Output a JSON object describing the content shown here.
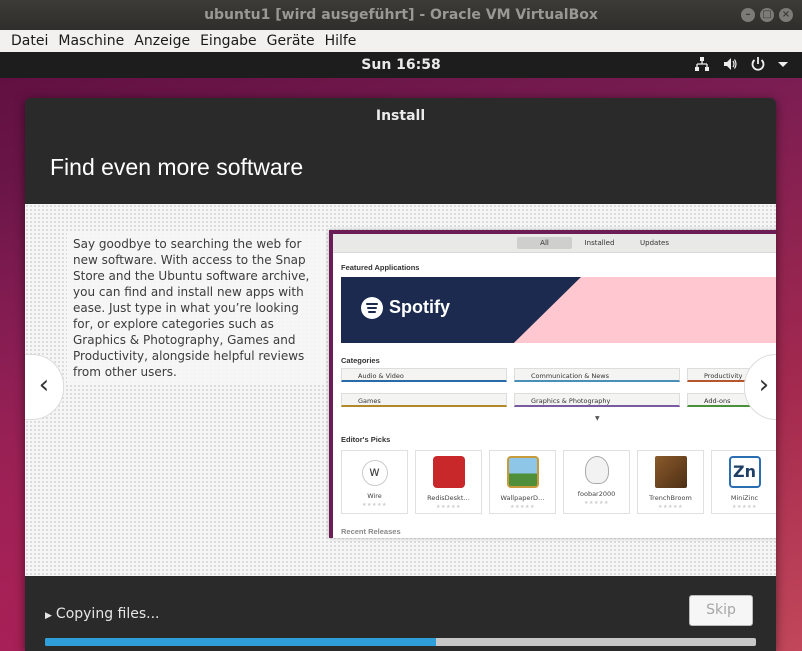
{
  "window": {
    "title": "ubuntu1 [wird ausgeführt] - Oracle VM VirtualBox",
    "controls": [
      "minimize-icon",
      "maximize-icon",
      "close-icon"
    ]
  },
  "menu": [
    "Datei",
    "Maschine",
    "Anzeige",
    "Eingabe",
    "Geräte",
    "Hilfe"
  ],
  "topbar": {
    "clock": "Sun 16:58",
    "icons": [
      "network-icon",
      "volume-icon",
      "power-icon",
      "chevron-down-icon"
    ]
  },
  "dialog": {
    "title": "Install",
    "heading": "Find even more software",
    "slide_text": "Say goodbye to searching the web for new software. With access to the Snap Store and the Ubuntu software archive, you can find and install new apps with ease. Just type in what you’re looking for, or explore categories such as Graphics & Photography, Games and Productivity, alongside helpful reviews from other users.",
    "prev": "‹",
    "next": "›",
    "preview": {
      "tabs": [
        "All",
        "Installed",
        "Updates"
      ],
      "featured_title": "Featured Applications",
      "banner_text": "Spotify",
      "categories_title": "Categories",
      "categories": [
        {
          "label": "Audio & Video",
          "color": "#2b6aa8"
        },
        {
          "label": "Communication & News",
          "color": "#4a8fb8"
        },
        {
          "label": "Productivity",
          "color": "#b5562f"
        },
        {
          "label": "Games",
          "color": "#b08a2a"
        },
        {
          "label": "Graphics & Photography",
          "color": "#7a5aa0"
        },
        {
          "label": "Add-ons",
          "color": "#4d8f3a"
        }
      ],
      "editors_title": "Editor's Picks",
      "apps": [
        "Wire",
        "RedisDeskt…",
        "WallpaperD…",
        "foobar2000",
        "TrenchBroom",
        "MiniZinc"
      ],
      "recent_title": "Recent Releases"
    },
    "status": "Copying files...",
    "skip": "Skip",
    "progress": 0.55
  },
  "colors": {
    "accent": "#2f9fdb",
    "dialog_bg": "#2a2a2a"
  }
}
